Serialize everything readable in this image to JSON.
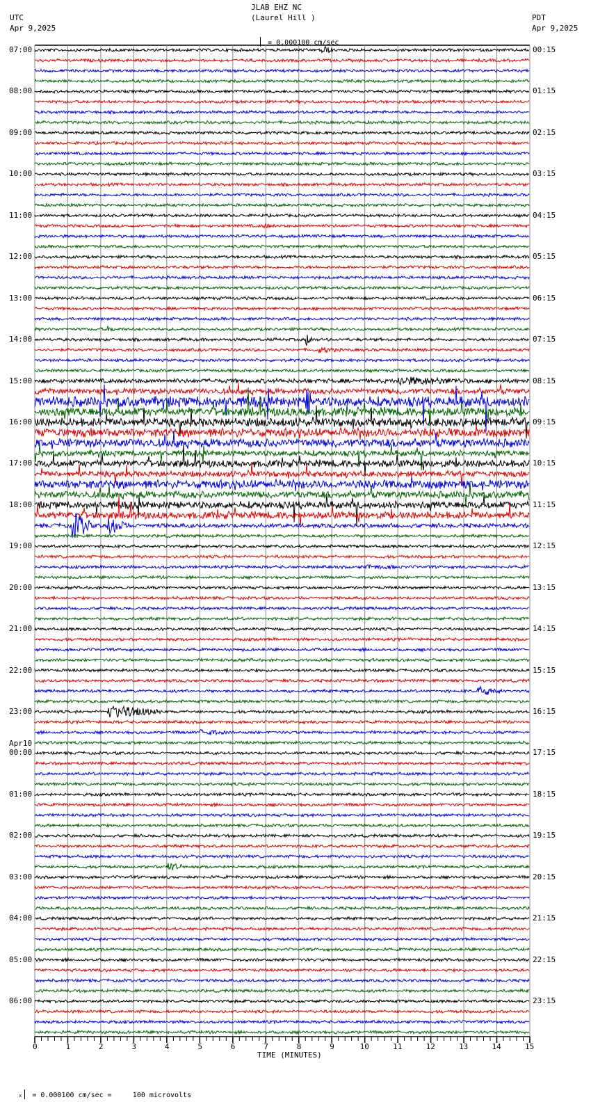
{
  "header": {
    "station": "JLAB EHZ NC",
    "location": "(Laurel Hill )",
    "left_tz": "UTC",
    "left_date": "Apr 9,2025",
    "right_tz": "PDT",
    "right_date": "Apr 9,2025",
    "scale": "= 0.000100 cm/sec"
  },
  "footer": {
    "scale": "= 0.000100 cm/sec =     100 microvolts",
    "mark": "x"
  },
  "chart_data": {
    "type": "line",
    "title": "JLAB EHZ NC (Laurel Hill )",
    "xlabel": "TIME (MINUTES)",
    "xlim": [
      0,
      15
    ],
    "x_ticks": [
      "0",
      "1",
      "2",
      "3",
      "4",
      "5",
      "6",
      "7",
      "8",
      "9",
      "10",
      "11",
      "12",
      "13",
      "14",
      "15"
    ],
    "grid": true,
    "trace_colors": [
      "#000000",
      "#e00000",
      "#0000e0",
      "#006400"
    ],
    "traces_per_hour": 4,
    "left_labels": [
      {
        "trace": 0,
        "text": "07:00"
      },
      {
        "trace": 4,
        "text": "08:00"
      },
      {
        "trace": 8,
        "text": "09:00"
      },
      {
        "trace": 12,
        "text": "10:00"
      },
      {
        "trace": 16,
        "text": "11:00"
      },
      {
        "trace": 20,
        "text": "12:00"
      },
      {
        "trace": 24,
        "text": "13:00"
      },
      {
        "trace": 28,
        "text": "14:00"
      },
      {
        "trace": 32,
        "text": "15:00"
      },
      {
        "trace": 36,
        "text": "16:00"
      },
      {
        "trace": 40,
        "text": "17:00"
      },
      {
        "trace": 44,
        "text": "18:00"
      },
      {
        "trace": 48,
        "text": "19:00"
      },
      {
        "trace": 52,
        "text": "20:00"
      },
      {
        "trace": 56,
        "text": "21:00"
      },
      {
        "trace": 60,
        "text": "22:00"
      },
      {
        "trace": 64,
        "text": "23:00"
      },
      {
        "trace": 68,
        "text": "00:00",
        "date": "Apr10"
      },
      {
        "trace": 72,
        "text": "01:00"
      },
      {
        "trace": 76,
        "text": "02:00"
      },
      {
        "trace": 80,
        "text": "03:00"
      },
      {
        "trace": 84,
        "text": "04:00"
      },
      {
        "trace": 88,
        "text": "05:00"
      },
      {
        "trace": 92,
        "text": "06:00"
      }
    ],
    "right_labels": [
      "00:15",
      "01:15",
      "02:15",
      "03:15",
      "04:15",
      "05:15",
      "06:15",
      "07:15",
      "08:15",
      "09:15",
      "10:15",
      "11:15",
      "12:15",
      "13:15",
      "14:15",
      "15:15",
      "16:15",
      "17:15",
      "18:15",
      "19:15",
      "20:15",
      "21:15",
      "22:15",
      "23:15"
    ],
    "trace_count": 96,
    "noise_amplitude": [
      2,
      2,
      2,
      2,
      2,
      2,
      2,
      2,
      2,
      2,
      2,
      2,
      2,
      2,
      2,
      2,
      2,
      2,
      2,
      2,
      2,
      2,
      2,
      2,
      2,
      2,
      2,
      2,
      2,
      2,
      2,
      2,
      3,
      4,
      7,
      6,
      6,
      6,
      6,
      4,
      5,
      4,
      6,
      5,
      5,
      5,
      3,
      2,
      2,
      2,
      2,
      2,
      2,
      2,
      2,
      2,
      2,
      2,
      2,
      2,
      2,
      2,
      2,
      2,
      2,
      2,
      2,
      2,
      2,
      2,
      2,
      2,
      2,
      2,
      2,
      2,
      2,
      2,
      2,
      2,
      2,
      2,
      2,
      2,
      2,
      2,
      2,
      2,
      2,
      2,
      2,
      2,
      2,
      2,
      2,
      2
    ],
    "events": [
      {
        "trace": 0,
        "minute": 8.7,
        "duration": 0.4,
        "amplitude": 7
      },
      {
        "trace": 17,
        "minute": 6.9,
        "duration": 0.4,
        "amplitude": 4
      },
      {
        "trace": 27,
        "minute": 2.2,
        "duration": 0.3,
        "amplitude": 5
      },
      {
        "trace": 28,
        "minute": 8.2,
        "duration": 0.2,
        "amplitude": 12
      },
      {
        "trace": 29,
        "minute": 8.6,
        "duration": 0.8,
        "amplitude": 5
      },
      {
        "trace": 32,
        "minute": 11.0,
        "duration": 2.6,
        "amplitude": 7
      },
      {
        "trace": 34,
        "minute": 8.2,
        "duration": 0.2,
        "amplitude": 30
      },
      {
        "trace": 46,
        "minute": 1.1,
        "duration": 0.6,
        "amplitude": 22
      },
      {
        "trace": 46,
        "minute": 2.2,
        "duration": 0.6,
        "amplitude": 14
      },
      {
        "trace": 50,
        "minute": 10.0,
        "duration": 1.5,
        "amplitude": 4
      },
      {
        "trace": 62,
        "minute": 13.4,
        "duration": 0.8,
        "amplitude": 8
      },
      {
        "trace": 64,
        "minute": 2.2,
        "duration": 1.6,
        "amplitude": 10
      },
      {
        "trace": 66,
        "minute": 5.0,
        "duration": 1.0,
        "amplitude": 5
      },
      {
        "trace": 79,
        "minute": 4.0,
        "duration": 0.5,
        "amplitude": 8
      }
    ]
  }
}
